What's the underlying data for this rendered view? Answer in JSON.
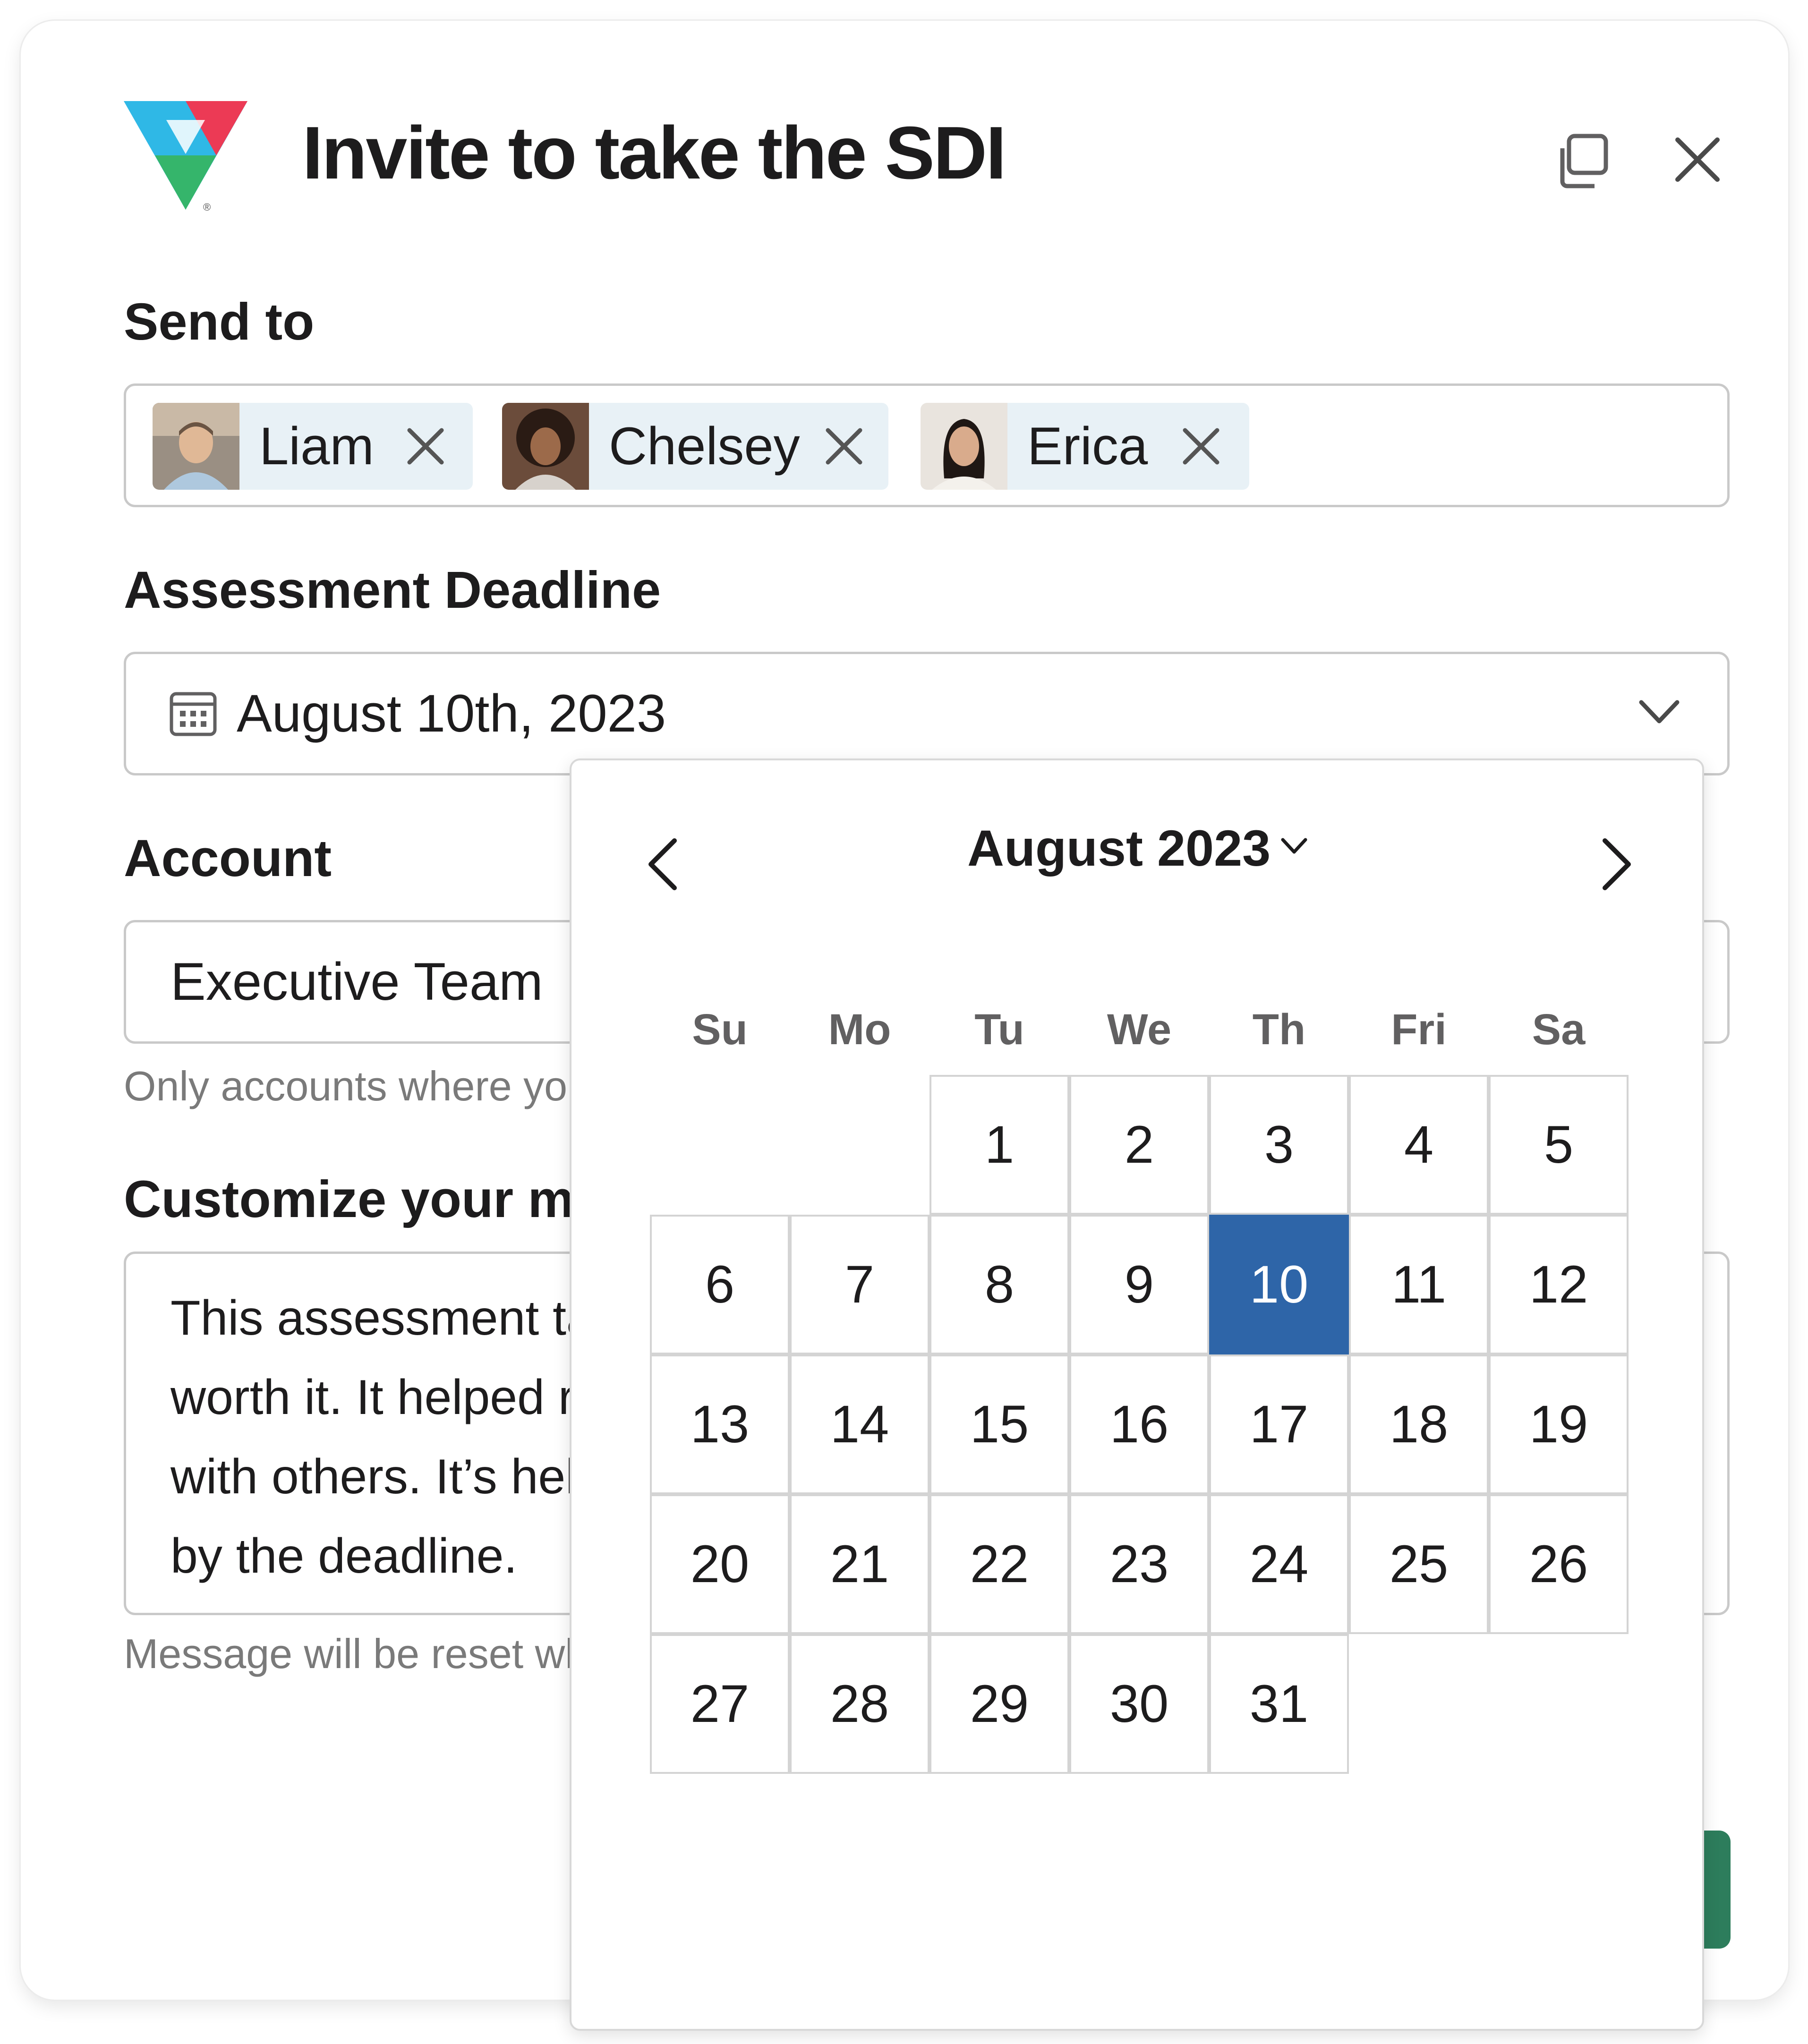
{
  "header": {
    "title": "Invite to take the SDI"
  },
  "send_to": {
    "label": "Send to",
    "recipients": [
      {
        "name": "Liam"
      },
      {
        "name": "Chelsey"
      },
      {
        "name": "Erica"
      }
    ]
  },
  "deadline": {
    "label": "Assessment Deadline",
    "value": "August 10th, 2023"
  },
  "account": {
    "label": "Account",
    "value": "Executive Team",
    "hint": "Only accounts where you"
  },
  "message": {
    "label": "Customize your mes",
    "value": "This assessment tal\nworth it. It helped r\nwith others. It’s hel\nby the deadline.",
    "hint": "Message will be reset wh"
  },
  "calendar": {
    "month_label": "August 2023",
    "weekdays": [
      "Su",
      "Mo",
      "Tu",
      "We",
      "Th",
      "Fri",
      "Sa"
    ],
    "first_weekday_index": 2,
    "days_in_month": 31,
    "selected_day": 10,
    "selected_color": "#2e65a8"
  },
  "colors": {
    "accent_green": "#2d7d5c",
    "chip_bg": "#e8f1f6"
  }
}
